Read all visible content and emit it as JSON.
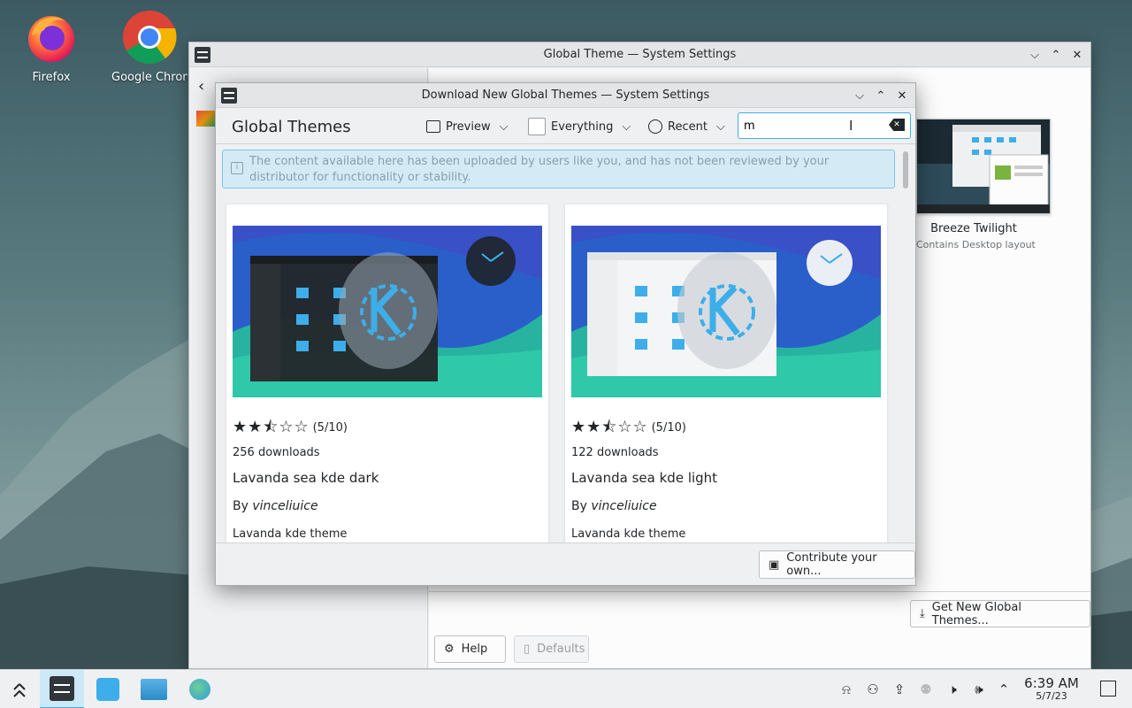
{
  "desktop": {
    "icons": [
      {
        "name": "firefox",
        "label": "Firefox"
      },
      {
        "name": "chrome",
        "label": "Google Chrome"
      }
    ]
  },
  "main_window": {
    "title": "Global Theme — System Settings",
    "breeze_twilight": {
      "name": "Breeze Twilight",
      "subtitle": "Contains Desktop layout"
    },
    "get_new_label": "Get New Global Themes...",
    "help_label": "Help",
    "defaults_label": "Defaults"
  },
  "dialog": {
    "title": "Download New Global Themes — System Settings",
    "heading": "Global Themes",
    "toolbar": {
      "preview_label": "Preview",
      "filter_label": "Everything",
      "sort_label": "Recent"
    },
    "search": {
      "value": "m",
      "placeholder": ""
    },
    "notice": "The content available here has been uploaded by users like you, and has not been reviewed by your distributor for functionality or stability.",
    "items": [
      {
        "rating_text": "(5/10)",
        "downloads": "256 downloads",
        "name": "Lavanda sea kde dark",
        "by": "By",
        "author": "vinceliuice",
        "description": "Lavanda kde theme",
        "variant": "dark"
      },
      {
        "rating_text": "(5/10)",
        "downloads": "122 downloads",
        "name": "Lavanda sea kde light",
        "by": "By",
        "author": "vinceliuice",
        "description": "Lavanda kde theme",
        "variant": "light"
      }
    ],
    "contribute_label": "Contribute your own..."
  },
  "taskbar": {
    "time": "6:39 AM",
    "date": "5/7/23"
  },
  "colors": {
    "accent": "#3daee9",
    "notice_bg": "#d4ebf6"
  }
}
